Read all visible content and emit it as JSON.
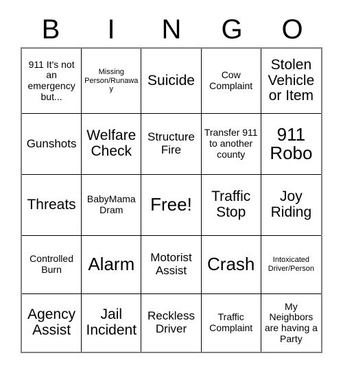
{
  "card": {
    "header_letters": [
      "B",
      "I",
      "N",
      "G",
      "O"
    ],
    "columns": 5,
    "rows": 5,
    "border_color": "#808080",
    "line_color": "#000000",
    "text_color": "#000000",
    "background_color": "#ffffff",
    "cells": [
      {
        "text": "911 It's not an emergency but...",
        "size": "s"
      },
      {
        "text": "Missing Person/Runaway",
        "size": "xs"
      },
      {
        "text": "Suicide",
        "size": "l"
      },
      {
        "text": "Cow Complaint",
        "size": "s"
      },
      {
        "text": "Stolen Vehicle or Item",
        "size": "l"
      },
      {
        "text": "Gunshots",
        "size": "m"
      },
      {
        "text": "Welfare Check",
        "size": "l"
      },
      {
        "text": "Structure Fire",
        "size": "m"
      },
      {
        "text": "Transfer 911 to another county",
        "size": "s"
      },
      {
        "text": "911 Robo",
        "size": "xl"
      },
      {
        "text": "Threats",
        "size": "l"
      },
      {
        "text": "BabyMama Dram",
        "size": "s"
      },
      {
        "text": "Free!",
        "size": "xl"
      },
      {
        "text": "Traffic Stop",
        "size": "l"
      },
      {
        "text": "Joy Riding",
        "size": "l"
      },
      {
        "text": "Controlled Burn",
        "size": "s"
      },
      {
        "text": "Alarm",
        "size": "xl"
      },
      {
        "text": "Motorist Assist",
        "size": "m"
      },
      {
        "text": "Crash",
        "size": "xl"
      },
      {
        "text": "Intoxicated Driver/Person",
        "size": "xs"
      },
      {
        "text": "Agency Assist",
        "size": "l"
      },
      {
        "text": "Jail Incident",
        "size": "l"
      },
      {
        "text": "Reckless Driver",
        "size": "m"
      },
      {
        "text": "Traffic Complaint",
        "size": "s"
      },
      {
        "text": "My Neighbors are having a Party",
        "size": "s"
      }
    ]
  }
}
